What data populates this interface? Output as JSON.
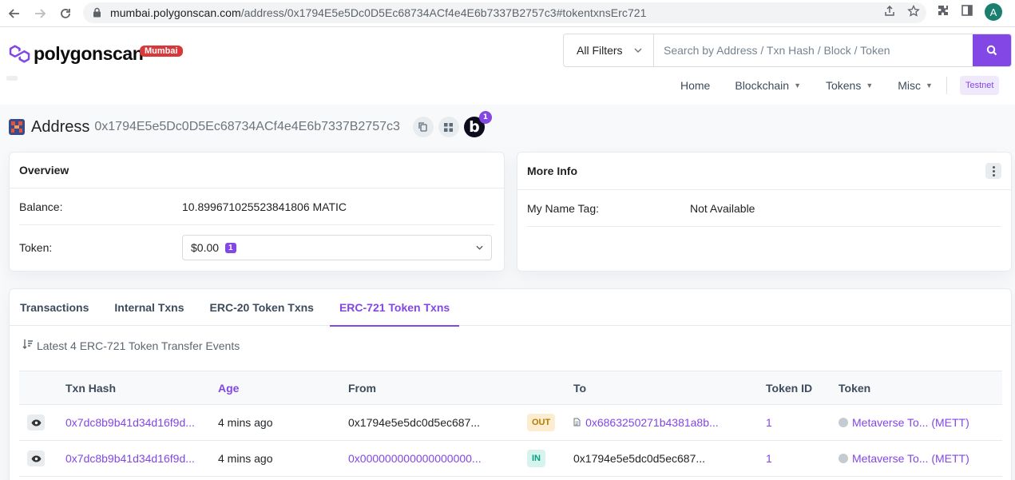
{
  "browser": {
    "url_host": "mumbai.polygonscan.com",
    "url_path": "/address/0x1794E5e5Dc0D5Ec68734ACf4e4E6b7337B2757c3#tokentxnsErc721",
    "profile_initial": "A"
  },
  "header": {
    "brand": "polygonscan",
    "network_badge": "Mumbai",
    "filter_label": "All Filters",
    "search_placeholder": "Search by Address / Txn Hash / Block / Token",
    "nav": {
      "home": "Home",
      "blockchain": "Blockchain",
      "tokens": "Tokens",
      "misc": "Misc",
      "testnet": "Testnet"
    }
  },
  "address": {
    "label": "Address",
    "hash": "0x1794E5e5Dc0D5Ec68734ACf4e4E6b7337B2757c3",
    "b_badge_letter": "b",
    "b_badge_count": "1"
  },
  "overview": {
    "title": "Overview",
    "balance_label": "Balance:",
    "balance_value": "10.899671025523841806 MATIC",
    "token_label": "Token:",
    "token_value": "$0.00",
    "token_count": "1"
  },
  "more_info": {
    "title": "More Info",
    "name_tag_label": "My Name Tag:",
    "name_tag_value": "Not Available"
  },
  "tabs": {
    "transactions": "Transactions",
    "internal": "Internal Txns",
    "erc20": "ERC-20 Token Txns",
    "erc721": "ERC-721 Token Txns"
  },
  "events_summary": "Latest 4 ERC-721 Token Transfer Events",
  "table": {
    "headers": {
      "txn_hash": "Txn Hash",
      "age": "Age",
      "from": "From",
      "to": "To",
      "token_id": "Token ID",
      "token": "Token"
    },
    "rows": [
      {
        "txn_hash": "0x7dc8b9b41d34d16f9d...",
        "age": "4 mins ago",
        "from": "0x1794e5e5dc0d5ec687...",
        "direction": "OUT",
        "to": "0x6863250271b4381a8b...",
        "token_id": "1",
        "token": "Metaverse To... (METT)"
      },
      {
        "txn_hash": "0x7dc8b9b41d34d16f9d...",
        "age": "4 mins ago",
        "from": "0x000000000000000000...",
        "direction": "IN",
        "to": "0x1794e5e5dc0d5ec687...",
        "token_id": "1",
        "token": "Metaverse To... (METT)"
      }
    ]
  },
  "colors": {
    "brand_purple": "#8247e5",
    "badge_red": "#d9383a",
    "out_bg": "#fdedd0",
    "in_bg": "#d6f3ec"
  }
}
